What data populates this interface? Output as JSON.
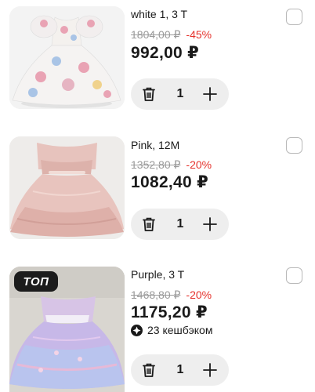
{
  "cart": {
    "items": [
      {
        "variant": "white 1, 3 T",
        "old_price": "1804,00 ₽",
        "discount": "-45%",
        "price": "992,00 ₽",
        "quantity": "1",
        "image": "white-floral-dress-photo"
      },
      {
        "variant": "Pink, 12M",
        "old_price": "1352,80 ₽",
        "discount": "-20%",
        "price": "1082,40 ₽",
        "quantity": "1",
        "image": "pink-tulle-dress-photo"
      },
      {
        "variant": "Purple, 3 T",
        "old_price": "1468,80 ₽",
        "discount": "-20%",
        "price": "1175,20 ₽",
        "quantity": "1",
        "badge": "ТОП",
        "cashback": "23 кешбэком",
        "image": "purple-tulle-dress-photo"
      }
    ]
  },
  "colors": {
    "discount": "#e5312b",
    "old_price": "#9a9a9a",
    "stepper_bg": "#eeeeee",
    "badge_bg": "#1c1c1c"
  },
  "icons": {
    "delete": "trash-icon",
    "increase": "plus-icon",
    "select": "checkbox",
    "cashback": "cashback-icon"
  }
}
